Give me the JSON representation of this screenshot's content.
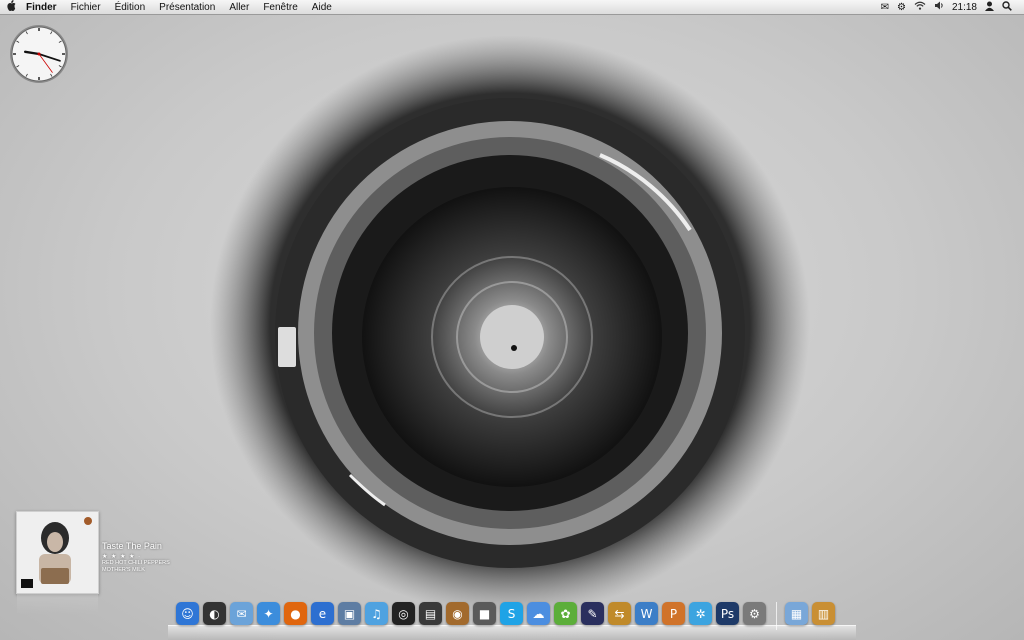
{
  "menubar": {
    "apple_icon": "apple-icon",
    "items": [
      "Finder",
      "Fichier",
      "Édition",
      "Présentation",
      "Aller",
      "Fenêtre",
      "Aide"
    ],
    "status": {
      "mail": "✉",
      "gear": "⚙",
      "wifi": "📶",
      "volume": "🔊",
      "time": "21:18",
      "user": "👤",
      "spotlight": "🔍"
    }
  },
  "clock": {
    "hour": 9,
    "minute": 18,
    "second": 24
  },
  "music": {
    "title": "Taste The Pain",
    "rating": "★ ★ ★ ★ ·",
    "artist": "RED HOT CHILI PEPPERS",
    "album": "MOTHER'S MILK"
  },
  "dock": {
    "apps": [
      {
        "name": "finder-icon",
        "glyph": "☺",
        "color": "#2f76d6"
      },
      {
        "name": "dashboard-icon",
        "glyph": "◐",
        "color": "#333333"
      },
      {
        "name": "mail-icon",
        "glyph": "✉",
        "color": "#6ba3d9"
      },
      {
        "name": "safari-icon",
        "glyph": "✦",
        "color": "#3c8ddc"
      },
      {
        "name": "firefox-icon",
        "glyph": "●",
        "color": "#e0660e"
      },
      {
        "name": "ie-icon",
        "glyph": "e",
        "color": "#2d6fd0"
      },
      {
        "name": "iphoto-icon",
        "glyph": "▣",
        "color": "#5e7da3"
      },
      {
        "name": "itunes-icon",
        "glyph": "♫",
        "color": "#4fa2e0"
      },
      {
        "name": "frontrow-icon",
        "glyph": "◎",
        "color": "#222222"
      },
      {
        "name": "dvd-player-icon",
        "glyph": "▤",
        "color": "#3a3a3a"
      },
      {
        "name": "aperture-icon",
        "glyph": "◉",
        "color": "#a26a2d"
      },
      {
        "name": "photo-booth-icon",
        "glyph": "■",
        "color": "#5a5a5a"
      },
      {
        "name": "skype-icon",
        "glyph": "S",
        "color": "#1fa3e6"
      },
      {
        "name": "ichat-icon",
        "glyph": "☁",
        "color": "#4c8ee0"
      },
      {
        "name": "adium-icon",
        "glyph": "✿",
        "color": "#5cae3a"
      },
      {
        "name": "script-editor-icon",
        "glyph": "✎",
        "color": "#2a2f5e"
      },
      {
        "name": "transmit-icon",
        "glyph": "⇆",
        "color": "#c08a2a"
      },
      {
        "name": "word-icon",
        "glyph": "W",
        "color": "#3c7ec7"
      },
      {
        "name": "powerpoint-icon",
        "glyph": "P",
        "color": "#d0732a"
      },
      {
        "name": "msn-icon",
        "glyph": "✲",
        "color": "#3ca4e0"
      },
      {
        "name": "photoshop-icon",
        "glyph": "Ps",
        "color": "#1e3a68"
      },
      {
        "name": "system-preferences-icon",
        "glyph": "⚙",
        "color": "#7a7a7a"
      },
      {
        "name": "applications-folder-icon",
        "glyph": "▦",
        "color": "#79a7d8"
      },
      {
        "name": "downloads-stack-icon",
        "glyph": "▥",
        "color": "#c98f34"
      }
    ]
  }
}
